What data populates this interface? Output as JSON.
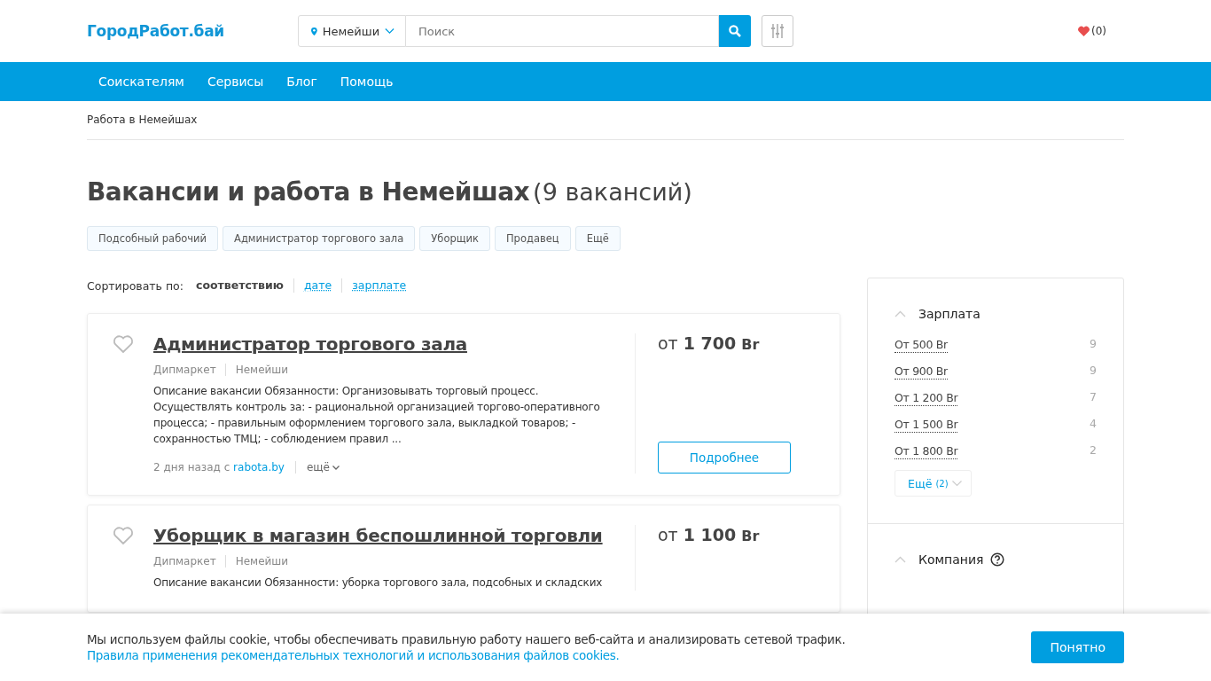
{
  "header": {
    "logo": "ГородРабот.бай",
    "city": "Немейши",
    "search": {
      "placeholder": "Поиск"
    },
    "favorites": "(0)"
  },
  "nav": [
    "Соискателям",
    "Сервисы",
    "Блог",
    "Помощь"
  ],
  "breadcrumb": "Работа в Немейшах",
  "title": "Вакансии и работа в Немейшах",
  "count": "(9 вакансий)",
  "tags": [
    "Подсобный рабочий",
    "Администратор торгового зала",
    "Уборщик",
    "Продавец",
    "Ещё"
  ],
  "sort": {
    "label": "Сортировать по:",
    "options": [
      {
        "label": "соответствию",
        "selected": true
      },
      {
        "label": "дате",
        "selected": false
      },
      {
        "label": "зарплате",
        "selected": false
      }
    ]
  },
  "vacancies": [
    {
      "title": "Администратор торгового зала",
      "company": "Дипмаркет",
      "city": "Немейши",
      "description": "Описание вакансии Обязанности: Организовывать торговый процесс. Осуществлять контроль за: - рациональной организацией торгово-оперативного процесса; - правильным оформлением торгового зала, выкладкой товаров; - сохранностью ТМЦ; - соблюдением правил ...",
      "posted": "2 дня назад с",
      "source": "rabota.by",
      "more": "ещё",
      "salary_prefix": "от",
      "salary": "1 700",
      "currency": "Br",
      "button": "Подробнее"
    },
    {
      "title": "Уборщик в магазин беспошлинной торговли",
      "company": "Дипмаркет",
      "city": "Немейши",
      "description": "Описание вакансии Обязанности: уборка торгового зала, подсобных и складских",
      "salary_prefix": "от",
      "salary": "1 100",
      "currency": "Br"
    }
  ],
  "filters": [
    {
      "title": "Зарплата",
      "expanded": true,
      "help": false,
      "items": [
        {
          "label": "От 500 Br",
          "count": "9"
        },
        {
          "label": "От 900 Br",
          "count": "9"
        },
        {
          "label": "От 1 200 Br",
          "count": "7"
        },
        {
          "label": "От 1 500 Br",
          "count": "4"
        },
        {
          "label": "От 1 800 Br",
          "count": "2"
        }
      ],
      "more": "Ещё",
      "more_count": "(2)"
    },
    {
      "title": "Компания",
      "expanded": true,
      "help": true
    }
  ],
  "cookie": {
    "text": "Мы используем файлы cookie, чтобы обеспечивать правильную работу нашего веб-сайта и анализировать сетевой трафик.",
    "link": "Правила применения рекомендательных технологий и использования файлов cookies.",
    "button": "Понятно"
  }
}
